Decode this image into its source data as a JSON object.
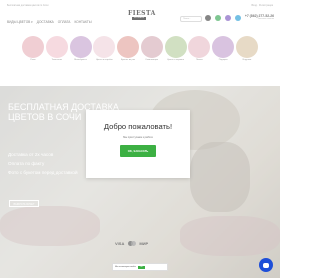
{
  "topbar": {
    "left_text": "Бесплатная доставка цветов по Сочи",
    "right_text": "Вход · Регистрация"
  },
  "header": {
    "nav": [
      "ВИДЫ ЦВЕТОВ ▾",
      "ДОСТАВКА",
      "ОПЛАТА",
      "КОНТАКТЫ"
    ],
    "logo": {
      "brand": "FIESTA",
      "tag": "FLOWERS"
    },
    "search_placeholder": "Поиск...",
    "phone": "+7 (862) 277-52-26",
    "phone_sub": "Заказать звонок"
  },
  "categories": [
    {
      "label": "Розы",
      "color": "#e8b4bc"
    },
    {
      "label": "Тюльпаны",
      "color": "#f2c6cf"
    },
    {
      "label": "Монобукеты",
      "color": "#c7a6d0"
    },
    {
      "label": "Цветы в коробке",
      "color": "#f0d5dc"
    },
    {
      "label": "Букеты из роз",
      "color": "#e3a7a0"
    },
    {
      "label": "Композиции",
      "color": "#d6b0b8"
    },
    {
      "label": "Цветы в корзине",
      "color": "#b8cfa1"
    },
    {
      "label": "Пионы",
      "color": "#e9c1c9"
    },
    {
      "label": "Подарки",
      "color": "#c5a4cf"
    },
    {
      "label": "Игрушки",
      "color": "#dbc6a8"
    }
  ],
  "hero": {
    "title": "Бесплатная доставка цветов в Сочи",
    "lines": [
      "Доставка от 2х часов",
      "Оплата по факту",
      "Фото с букетом перед доставкой"
    ],
    "button": "ВЫБРАТЬ БУКЕТ"
  },
  "modal": {
    "title": "Добро пожаловать!",
    "subtitle": "Мы приступаем к работе",
    "button": "OK, ЗАКАЗАТЬ"
  },
  "payment": {
    "visa": "VISA",
    "mir": "МИР"
  },
  "cookie": {
    "text": "Мы используем cookie",
    "ok": "OK"
  },
  "colors": {
    "accent": "#3cb043",
    "chat": "#1d4ed8"
  },
  "icons": [
    "phone-icon",
    "whatsapp-icon",
    "viber-icon",
    "telegram-icon"
  ]
}
